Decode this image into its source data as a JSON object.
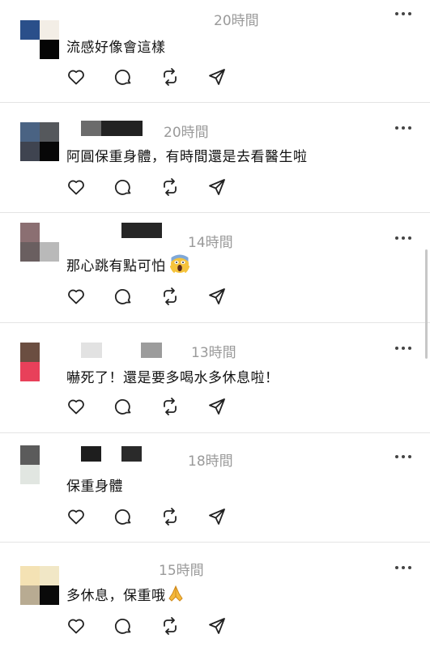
{
  "comments": [
    {
      "time": "20時間",
      "text": "流感好像會這樣"
    },
    {
      "time": "20時間",
      "text": "阿圓保重身體，有時間還是去看醫生啦"
    },
    {
      "time": "14時間",
      "text": "那心跳有點可怕"
    },
    {
      "time": "13時間",
      "text": "嚇死了！還是要多喝水多休息啦！"
    },
    {
      "time": "18時間",
      "text": "保重身體"
    },
    {
      "time": "15時間",
      "text": "多休息，保重哦"
    }
  ],
  "icons": {
    "like": "heart-icon",
    "reply": "comment-bubble-icon",
    "repost": "repost-icon",
    "share": "send-icon",
    "more": "more-dots-icon",
    "emoji_fear": "face-screaming-in-fear-emoji",
    "emoji_pray": "folded-hands-emoji"
  },
  "colors": {
    "timestamp": "#9a9a9a",
    "divider": "#e4e4e4",
    "icon": "#222222"
  }
}
